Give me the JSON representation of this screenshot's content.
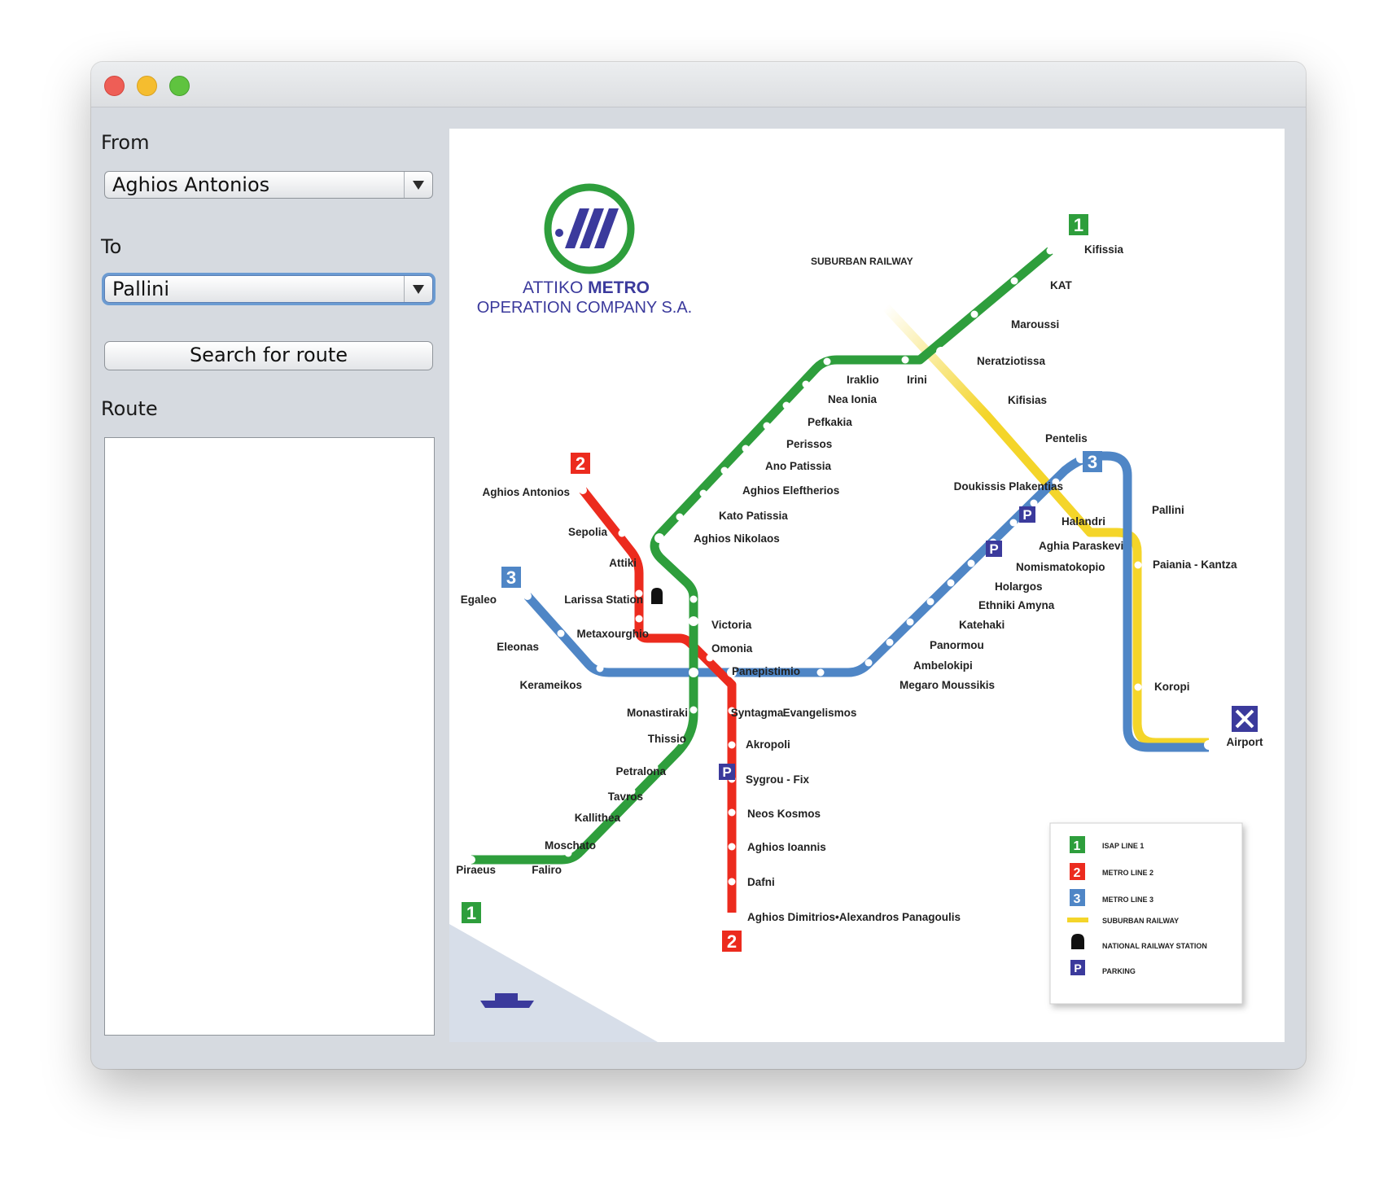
{
  "form": {
    "from_label": "From",
    "from_value": "Aghios Antonios",
    "to_label": "To",
    "to_value": "Pallini",
    "search_button": "Search for route",
    "route_label": "Route"
  },
  "colors": {
    "line1": "#2e9e3c",
    "line2": "#ec2b1e",
    "line3": "#4f86c6",
    "suburban": "#f4d52a",
    "brand": "#3b3a9c"
  },
  "map": {
    "logo_line1_a": "ATTIKO ",
    "logo_line1_b": "METRO",
    "logo_line2": "OPERATION COMPANY S.A.",
    "suburban_label": "SUBURBAN RAILWAY",
    "badges": {
      "line1": "1",
      "line2": "2",
      "line3": "3",
      "parking": "P"
    },
    "stations": {
      "kifissia": "Kifissia",
      "kat": "KAT",
      "maroussi": "Maroussi",
      "neratziotissa": "Neratziotissa",
      "irini": "Irini",
      "iraklio": "Iraklio",
      "nea_ionia": "Nea Ionia",
      "pefkakia": "Pefkakia",
      "perissos": "Perissos",
      "ano_patissia": "Ano Patissia",
      "aghios_eleftherios": "Aghios Eleftherios",
      "kato_patissia": "Kato Patissia",
      "aghios_nikolaos": "Aghios Nikolaos",
      "attiki": "Attiki",
      "victoria": "Victoria",
      "omonia": "Omonia",
      "monastiraki": "Monastiraki",
      "thissio": "Thissio",
      "petralona": "Petralona",
      "tavros": "Tavros",
      "kallithea": "Kallithea",
      "moschato": "Moschato",
      "faliro": "Faliro",
      "piraeus": "Piraeus",
      "aghios_antonios": "Aghios Antonios",
      "sepolia": "Sepolia",
      "larissa_station": "Larissa Station",
      "metaxourghio": "Metaxourghio",
      "panepistimio": "Panepistimio",
      "syntagma": "Syntagma",
      "akropoli": "Akropoli",
      "sygrou_fix": "Sygrou - Fix",
      "neos_kosmos": "Neos Kosmos",
      "aghios_ioannis": "Aghios Ioannis",
      "dafni": "Dafni",
      "aghios_dimitrios": "Aghios Dimitrios•Alexandros Panagoulis",
      "egaleo": "Egaleo",
      "eleonas": "Eleonas",
      "kerameikos": "Kerameikos",
      "evangelismos": "Evangelismos",
      "megaro_moussikis": "Megaro Moussikis",
      "ambelokipi": "Ambelokipi",
      "panormou": "Panormou",
      "katehaki": "Katehaki",
      "ethniki_amyna": "Ethniki Amyna",
      "holargos": "Holargos",
      "nomismatokopio": "Nomismatokopio",
      "aghia_paraskevi": "Aghia Paraskevi",
      "halandri": "Halandri",
      "doukissis_plakentias": "Doukissis Plakentias",
      "kifisias": "Kifisias",
      "pentelis": "Pentelis",
      "pallini": "Pallini",
      "paiania_kantza": "Paiania - Kantza",
      "koropi": "Koropi",
      "airport": "Airport"
    },
    "legend": {
      "line1": "ISAP LINE 1",
      "line2": "METRO LINE 2",
      "line3": "METRO LINE 3",
      "suburban": "SUBURBAN RAILWAY",
      "railway": "NATIONAL RAILWAY STATION",
      "parking": "PARKING"
    }
  }
}
